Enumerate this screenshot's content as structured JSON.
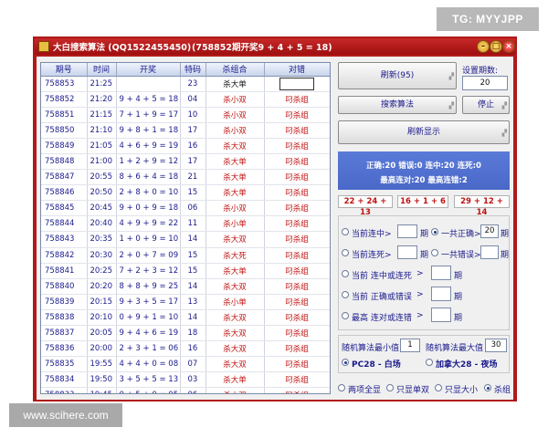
{
  "watermark_top": "TG: MYYJPP",
  "watermark_bottom": "www.scihere.com",
  "window": {
    "title": "大白搜索算法 (QQ1522455450)",
    "result": "(758852期开奖9 + 4 + 5 = 18)"
  },
  "table": {
    "headers": [
      "期号",
      "时间",
      "开奖",
      "特码",
      "杀组合",
      "对错"
    ],
    "rows": [
      {
        "period": "758853",
        "time": "21:25",
        "draw": "",
        "sum": "23",
        "kill": "杀大单",
        "result": ""
      },
      {
        "period": "758852",
        "time": "21:20",
        "draw": "9 + 4 + 5 = 18",
        "sum": "04",
        "kill": "杀小双",
        "result": "叼杀组"
      },
      {
        "period": "758851",
        "time": "21:15",
        "draw": "7 + 1 + 9 = 17",
        "sum": "10",
        "kill": "杀小双",
        "result": "叼杀组"
      },
      {
        "period": "758850",
        "time": "21:10",
        "draw": "9 + 8 + 1 = 18",
        "sum": "17",
        "kill": "杀小双",
        "result": "叼杀组"
      },
      {
        "period": "758849",
        "time": "21:05",
        "draw": "4 + 6 + 9 = 19",
        "sum": "16",
        "kill": "杀大双",
        "result": "叼杀组"
      },
      {
        "period": "758848",
        "time": "21:00",
        "draw": "1 + 2 + 9 = 12",
        "sum": "17",
        "kill": "杀大单",
        "result": "叼杀组"
      },
      {
        "period": "758847",
        "time": "20:55",
        "draw": "8 + 6 + 4 = 18",
        "sum": "21",
        "kill": "杀大单",
        "result": "叼杀组"
      },
      {
        "period": "758846",
        "time": "20:50",
        "draw": "2 + 8 + 0 = 10",
        "sum": "15",
        "kill": "杀大单",
        "result": "叼杀组"
      },
      {
        "period": "758845",
        "time": "20:45",
        "draw": "9 + 0 + 9 = 18",
        "sum": "06",
        "kill": "杀小双",
        "result": "叼杀组"
      },
      {
        "period": "758844",
        "time": "20:40",
        "draw": "4 + 9 + 9 = 22",
        "sum": "11",
        "kill": "杀小单",
        "result": "叼杀组"
      },
      {
        "period": "758843",
        "time": "20:35",
        "draw": "1 + 0 + 9 = 10",
        "sum": "14",
        "kill": "杀大双",
        "result": "叼杀组"
      },
      {
        "period": "758842",
        "time": "20:30",
        "draw": "2 + 0 + 7 = 09",
        "sum": "15",
        "kill": "杀大死",
        "result": "叼杀组"
      },
      {
        "period": "758841",
        "time": "20:25",
        "draw": "7 + 2 + 3 = 12",
        "sum": "15",
        "kill": "杀大单",
        "result": "叼杀组"
      },
      {
        "period": "758840",
        "time": "20:20",
        "draw": "8 + 8 + 9 = 25",
        "sum": "14",
        "kill": "杀大双",
        "result": "叼杀组"
      },
      {
        "period": "758839",
        "time": "20:15",
        "draw": "9 + 3 + 5 = 17",
        "sum": "13",
        "kill": "杀小单",
        "result": "叼杀组"
      },
      {
        "period": "758838",
        "time": "20:10",
        "draw": "0 + 9 + 1 = 10",
        "sum": "14",
        "kill": "杀大双",
        "result": "叼杀组"
      },
      {
        "period": "758837",
        "time": "20:05",
        "draw": "9 + 4 + 6 = 19",
        "sum": "18",
        "kill": "杀大双",
        "result": "叼杀组"
      },
      {
        "period": "758836",
        "time": "20:00",
        "draw": "2 + 3 + 1 = 06",
        "sum": "16",
        "kill": "杀大双",
        "result": "叼杀组"
      },
      {
        "period": "758835",
        "time": "19:55",
        "draw": "4 + 4 + 0 = 08",
        "sum": "07",
        "kill": "杀大双",
        "result": "叼杀组"
      },
      {
        "period": "758834",
        "time": "19:50",
        "draw": "3 + 5 + 5 = 13",
        "sum": "03",
        "kill": "杀大单",
        "result": "叼杀组"
      },
      {
        "period": "758833",
        "time": "19:45",
        "draw": "0 + 5 + 0 = 05",
        "sum": "06",
        "kill": "杀小双",
        "result": "叼杀组"
      }
    ]
  },
  "controls": {
    "refresh_label": "刷新(95)",
    "period_count_label": "设置期数:",
    "period_count_value": "20",
    "search_label": "搜索算法",
    "stop_label": "停止",
    "refresh_display_label": "刷新显示",
    "status_line1": "正确:20 错误:0 连中:20 连死:0",
    "status_line2": "最高连对:20 最高连错:2",
    "tag1": "22 + 24 + 13",
    "tag2": "16 + 1 + 6",
    "tag3": "29 + 12 + 14",
    "opt_current_hit": "当前连中>",
    "opt_total_right": "一共正确>",
    "total_right_value": "20",
    "opt_current_dead": "当前连死>",
    "opt_total_wrong": "一共错误>",
    "unit_period": "期",
    "opt_hit_or_dead": "当前 连中或连死",
    "opt_right_or_wrong": "当前 正确或错误",
    "opt_max_streak": "最高 连对或连错",
    "gt": ">",
    "rand_min_label": "随机算法最小值",
    "rand_min_value": "1",
    "rand_max_label": "随机算法最大值",
    "rand_max_value": "30",
    "mode_pc28": "PC28 - 白场",
    "mode_canada": "加拿大28 - 夜场",
    "filter_all": "两项全显",
    "filter_oddeven": "只显单双",
    "filter_size": "只显大小",
    "filter_kill": "杀组"
  }
}
